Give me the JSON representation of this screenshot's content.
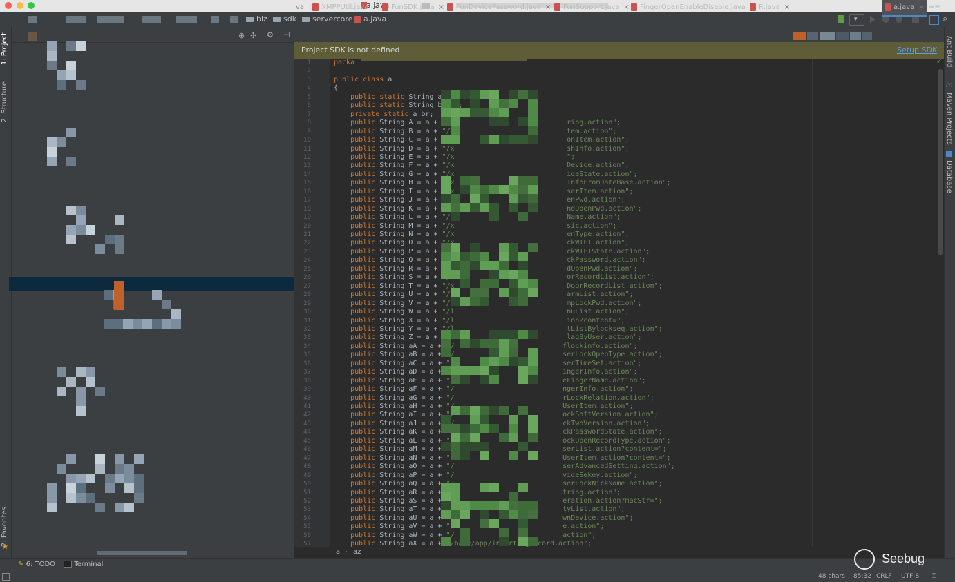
{
  "window": {
    "title": "a.java"
  },
  "breadcrumb": [
    {
      "label": "biz",
      "kind": "folder"
    },
    {
      "label": "sdk",
      "kind": "folder"
    },
    {
      "label": "servercore",
      "kind": "folder"
    },
    {
      "label": "a.java",
      "kind": "java"
    }
  ],
  "left_strip": {
    "project": "1: Project",
    "structure": "2: Structure",
    "favorites": "2: Favorites"
  },
  "right_strip": {
    "ant": "Ant Build",
    "maven": "Maven Projects",
    "database": "Database"
  },
  "tabs": [
    {
      "label": "XMPPUtil.java"
    },
    {
      "label": "FunSDK.java"
    },
    {
      "label": "FunDevicePassword.java"
    },
    {
      "label": "FunSupport.java"
    },
    {
      "label": "FingerOpenEnableDisable.java"
    },
    {
      "label": "R.java"
    },
    {
      "label": "a.java"
    }
  ],
  "banner": {
    "message": "Project SDK is not defined",
    "action": "Setup SDK"
  },
  "code_lines": [
    [
      [
        "kw",
        "packa"
      ]
    ],
    [],
    [
      [
        "kw",
        "public class "
      ],
      [
        "p",
        "a"
      ]
    ],
    [
      [
        "p",
        "{"
      ]
    ],
    [
      [
        "kw",
        "    public static "
      ],
      [
        "p",
        "String a = "
      ],
      [
        "str",
        "m\";"
      ]
    ],
    [
      [
        "kw",
        "    public static "
      ],
      [
        "p",
        "String b = "
      ],
      [
        "str",
        "\";"
      ]
    ],
    [
      [
        "kw",
        "    private static "
      ],
      [
        "p",
        "a br;"
      ]
    ],
    [
      [
        "kw",
        "    public "
      ],
      [
        "p",
        "String A = a + "
      ],
      [
        "str",
        "\"/p                           ring.action\";"
      ]
    ],
    [
      [
        "kw",
        "    public "
      ],
      [
        "p",
        "String B = a + "
      ],
      [
        "str",
        "\"/x                           tem.action\";"
      ]
    ],
    [
      [
        "kw",
        "    public "
      ],
      [
        "p",
        "String C = a + "
      ],
      [
        "str",
        "\"/x                           onItem.action\";"
      ]
    ],
    [
      [
        "kw",
        "    public "
      ],
      [
        "p",
        "String D = a + "
      ],
      [
        "str",
        "\"/x                           shInfo.action\";"
      ]
    ],
    [
      [
        "kw",
        "    public "
      ],
      [
        "p",
        "String E = a + "
      ],
      [
        "str",
        "\"/x                           \";"
      ]
    ],
    [
      [
        "kw",
        "    public "
      ],
      [
        "p",
        "String F = a + "
      ],
      [
        "str",
        "\"/x                           Device.action\";"
      ]
    ],
    [
      [
        "kw",
        "    public "
      ],
      [
        "p",
        "String G = a + "
      ],
      [
        "str",
        "\"/x                           iceState.action\";"
      ]
    ],
    [
      [
        "kw",
        "    public "
      ],
      [
        "p",
        "String H = a + "
      ],
      [
        "str",
        "\"/x                           InfoFromDateBase.action\";"
      ]
    ],
    [
      [
        "kw",
        "    public "
      ],
      [
        "p",
        "String I = a + "
      ],
      [
        "str",
        "\"/x                           serItem.action\";"
      ]
    ],
    [
      [
        "kw",
        "    public "
      ],
      [
        "p",
        "String J = a + "
      ],
      [
        "str",
        "\"/x                           enPwd.action\";"
      ]
    ],
    [
      [
        "kw",
        "    public "
      ],
      [
        "p",
        "String K = a + "
      ],
      [
        "str",
        "\"/x                           ndOpenPwd.action\";"
      ]
    ],
    [
      [
        "kw",
        "    public "
      ],
      [
        "p",
        "String L = a + "
      ],
      [
        "str",
        "\"/x                           Name.action\";"
      ]
    ],
    [
      [
        "kw",
        "    public "
      ],
      [
        "p",
        "String M = a + "
      ],
      [
        "str",
        "\"/x                           sic.action\";"
      ]
    ],
    [
      [
        "kw",
        "    public "
      ],
      [
        "p",
        "String N = a + "
      ],
      [
        "str",
        "\"/x                           enType.action\";"
      ]
    ],
    [
      [
        "kw",
        "    public "
      ],
      [
        "p",
        "String O = a + "
      ],
      [
        "str",
        "\"/x                           ckWIFI.action\";"
      ]
    ],
    [
      [
        "kw",
        "    public "
      ],
      [
        "p",
        "String P = a + "
      ],
      [
        "str",
        "\"/x                           ckWIFIState.action\";"
      ]
    ],
    [
      [
        "kw",
        "    public "
      ],
      [
        "p",
        "String Q = a + "
      ],
      [
        "str",
        "\"/x                           ckPassword.action\";"
      ]
    ],
    [
      [
        "kw",
        "    public "
      ],
      [
        "p",
        "String R = a + "
      ],
      [
        "str",
        "\"/x                           dOpenPwd.action\";"
      ]
    ],
    [
      [
        "kw",
        "    public "
      ],
      [
        "p",
        "String S = a + "
      ],
      [
        "str",
        "\"/x                           orRecordList.action\";"
      ]
    ],
    [
      [
        "kw",
        "    public "
      ],
      [
        "p",
        "String T = a + "
      ],
      [
        "str",
        "\"/x                           DoorRecordList.action\";"
      ]
    ],
    [
      [
        "kw",
        "    public "
      ],
      [
        "p",
        "String U = a + "
      ],
      [
        "str",
        "\"/x                           armList.action\";"
      ]
    ],
    [
      [
        "kw",
        "    public "
      ],
      [
        "p",
        "String V = a + "
      ],
      [
        "str",
        "\"/x                           mpLockPwd.action\";"
      ]
    ],
    [
      [
        "kw",
        "    public "
      ],
      [
        "p",
        "String W = a + "
      ],
      [
        "str",
        "\"/l                           nuList.action\";"
      ]
    ],
    [
      [
        "kw",
        "    public "
      ],
      [
        "p",
        "String X = a + "
      ],
      [
        "str",
        "\"/l                           ion?content=\";"
      ]
    ],
    [
      [
        "kw",
        "    public "
      ],
      [
        "p",
        "String Y = a + "
      ],
      [
        "str",
        "\"/l                           tListBylockseq.action\";"
      ]
    ],
    [
      [
        "kw",
        "    public "
      ],
      [
        "p",
        "String Z = a + "
      ],
      [
        "str",
        "\"/l                           lagByUser.action\";"
      ]
    ],
    [
      [
        "kw",
        "    public "
      ],
      [
        "p",
        "String aA = a + "
      ],
      [
        "str",
        "\"/                          flockinfo.action\";"
      ]
    ],
    [
      [
        "kw",
        "    public "
      ],
      [
        "p",
        "String aB = a + "
      ],
      [
        "str",
        "\"/                          serLockOpenType.action\";"
      ]
    ],
    [
      [
        "kw",
        "    public "
      ],
      [
        "p",
        "String aC = a + "
      ],
      [
        "str",
        "\"/                          serTimeSet.action\";"
      ]
    ],
    [
      [
        "kw",
        "    public "
      ],
      [
        "p",
        "String aD = a + "
      ],
      [
        "str",
        "\"/                          ingerInfo.action\";"
      ]
    ],
    [
      [
        "kw",
        "    public "
      ],
      [
        "p",
        "String aE = a + "
      ],
      [
        "str",
        "\"/                          eFingerName.action\";"
      ]
    ],
    [
      [
        "kw",
        "    public "
      ],
      [
        "p",
        "String aF = a + "
      ],
      [
        "str",
        "\"/                          ngerInfo.action\";"
      ]
    ],
    [
      [
        "kw",
        "    public "
      ],
      [
        "p",
        "String aG = a + "
      ],
      [
        "str",
        "\"/                          rLockRelation.action\";"
      ]
    ],
    [
      [
        "kw",
        "    public "
      ],
      [
        "p",
        "String aH = a + "
      ],
      [
        "str",
        "\"/                          UserItem.action\";"
      ]
    ],
    [
      [
        "kw",
        "    public "
      ],
      [
        "p",
        "String aI = a + "
      ],
      [
        "str",
        "\"/                          ockSoftVersion.action\";"
      ]
    ],
    [
      [
        "kw",
        "    public "
      ],
      [
        "p",
        "String aJ = a + "
      ],
      [
        "str",
        "\"/                          ckTwoVersion.action\";"
      ]
    ],
    [
      [
        "kw",
        "    public "
      ],
      [
        "p",
        "String aK = a + "
      ],
      [
        "str",
        "\"/                          ckPasswordState.action\";"
      ]
    ],
    [
      [
        "kw",
        "    public "
      ],
      [
        "p",
        "String aL = a + "
      ],
      [
        "str",
        "\"/                          ockOpenRecordType.action\";"
      ]
    ],
    [
      [
        "kw",
        "    public "
      ],
      [
        "p",
        "String aM = a + "
      ],
      [
        "str",
        "\"/                          serList.action?content=\";"
      ]
    ],
    [
      [
        "kw",
        "    public "
      ],
      [
        "p",
        "String aN = a + "
      ],
      [
        "str",
        "\"/                          UserItem.action?content=\";"
      ]
    ],
    [
      [
        "kw",
        "    public "
      ],
      [
        "p",
        "String aO = a + "
      ],
      [
        "str",
        "\"/                          serAdvancedSetting.action\";"
      ]
    ],
    [
      [
        "kw",
        "    public "
      ],
      [
        "p",
        "String aP = a + "
      ],
      [
        "str",
        "\"/                          viceSekey.action\";"
      ]
    ],
    [
      [
        "kw",
        "    public "
      ],
      [
        "p",
        "String aQ = a + "
      ],
      [
        "str",
        "\"/                          serLockNickName.action\";"
      ]
    ],
    [
      [
        "kw",
        "    public "
      ],
      [
        "p",
        "String aR = a + "
      ],
      [
        "str",
        "\"/                          tring.action\";"
      ]
    ],
    [
      [
        "kw",
        "    public "
      ],
      [
        "p",
        "String aS = a + "
      ],
      [
        "str",
        "\"/                          eration.action?macStr=\";"
      ]
    ],
    [
      [
        "kw",
        "    public "
      ],
      [
        "p",
        "String aT = a + "
      ],
      [
        "str",
        "\"/                          tyList.action\";"
      ]
    ],
    [
      [
        "kw",
        "    public "
      ],
      [
        "p",
        "String aU = a + "
      ],
      [
        "str",
        "\"/                          wnDevice.action\";"
      ]
    ],
    [
      [
        "kw",
        "    public "
      ],
      [
        "p",
        "String aV = a + "
      ],
      [
        "str",
        "\"/                          e.action\";"
      ]
    ],
    [
      [
        "kw",
        "    public "
      ],
      [
        "p",
        "String aW = a + "
      ],
      [
        "str",
        "\"/                          action\";"
      ]
    ],
    [
      [
        "kw",
        "    public "
      ],
      [
        "p",
        "String aX = a + "
      ],
      [
        "str",
        "\"/base/app/insertLogRecord.action\";"
      ]
    ]
  ],
  "editor_breadcrumb": {
    "cls": "a",
    "member": "az"
  },
  "bottom_tools": {
    "todo": "6: TODO",
    "terminal": "Terminal"
  },
  "status": {
    "chars": "48 chars",
    "pos": "85:32",
    "line_sep": "CRLF",
    "encoding": "UTF-8"
  },
  "watermark": {
    "brand": "Seebug"
  },
  "colors": {
    "keyword": "#cc7832",
    "string": "#6a8759",
    "banner": "#5e5d38",
    "link": "#589df6"
  }
}
